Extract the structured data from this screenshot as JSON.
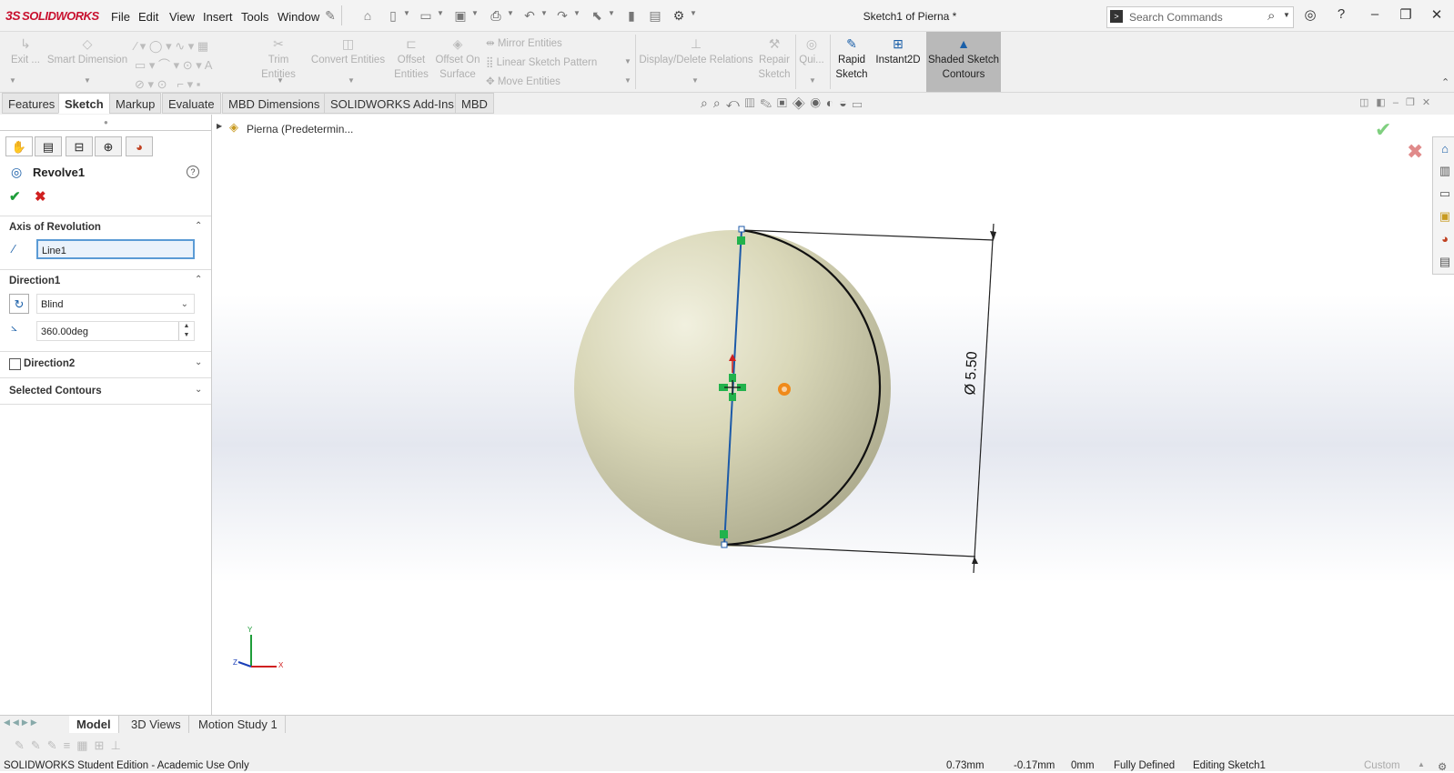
{
  "app": {
    "logo": "SOLIDWORKS",
    "logo_prefix": "3S"
  },
  "menu": [
    "File",
    "Edit",
    "View",
    "Insert",
    "Tools",
    "Window"
  ],
  "window": {
    "title": "Sketch1 of Pierna *"
  },
  "search": {
    "placeholder": "Search Commands"
  },
  "commands": {
    "exit": "Exit ...",
    "smart_dimension": "Smart Dimension",
    "trim_entities": "Trim Entities",
    "convert_entities": "Convert Entities",
    "offset_entities_1": "Offset",
    "offset_entities_2": "Entities",
    "offset_surface_1": "Offset On",
    "offset_surface_2": "Surface",
    "mirror_entities": "Mirror Entities",
    "linear_pattern": "Linear Sketch Pattern",
    "move_entities": "Move Entities",
    "display_delete_relations": "Display/Delete Relations",
    "repair_sketch_1": "Repair",
    "repair_sketch_2": "Sketch",
    "quick_snaps": "Qui...",
    "rapid_sketch_1": "Rapid",
    "rapid_sketch_2": "Sketch",
    "instant2d": "Instant2D",
    "shaded_contours_1": "Shaded Sketch",
    "shaded_contours_2": "Contours"
  },
  "tabs": [
    "Features",
    "Sketch",
    "Markup",
    "Evaluate",
    "MBD Dimensions",
    "SOLIDWORKS Add-Ins",
    "MBD"
  ],
  "active_tab": "Sketch",
  "tree": {
    "root": "Pierna  (Predetermin..."
  },
  "property_manager": {
    "feature_name": "Revolve1",
    "axis_section": "Axis of Revolution",
    "axis_value": "Line1",
    "direction1_section": "Direction1",
    "end_condition": "Blind",
    "angle": "360.00deg",
    "direction2_section": "Direction2",
    "direction2_checked": false,
    "contours_section": "Selected Contours"
  },
  "dimension": {
    "label": "Ø 5.50"
  },
  "triad": {
    "x": "X",
    "y": "Y",
    "z": "Z"
  },
  "bottom_tabs": [
    "Model",
    "3D Views",
    "Motion Study 1"
  ],
  "active_bottom_tab": "Model",
  "status": {
    "edition": "SOLIDWORKS Student Edition - Academic Use Only",
    "x": "0.73mm",
    "y": "-0.17mm",
    "z": "0mm",
    "state": "Fully Defined",
    "editing": "Editing Sketch1",
    "units": "Custom"
  },
  "colors": {
    "sphere": "#d9d7b8",
    "accent": "#1a5fa8",
    "ok_green": "#1f9d3a",
    "cancel_red": "#d02020",
    "logo_red": "#c8102e"
  }
}
